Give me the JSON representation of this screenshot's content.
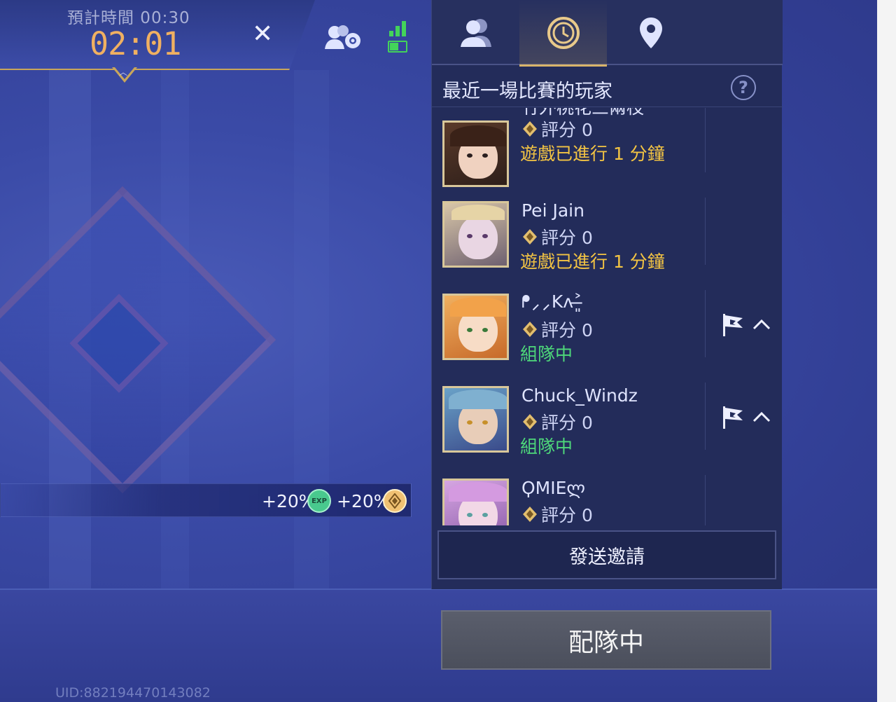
{
  "timer": {
    "estimated_label": "預計時間 00:30",
    "elapsed": "02:01"
  },
  "icons": {
    "close": "close-icon",
    "friends_settings": "friends-settings-icon",
    "signal": "signal-icon",
    "battery": "battery-icon"
  },
  "colors": {
    "accent_gold": "#d9b56a",
    "timer_orange": "#f0b061",
    "status_ingame": "#f3c443",
    "status_team": "#4ed87a",
    "signal_green": "#43d35a"
  },
  "tabs": [
    {
      "icon": "friends-icon"
    },
    {
      "icon": "recent-history-icon",
      "active": true
    },
    {
      "icon": "location-icon"
    }
  ],
  "panel": {
    "title": "最近一場比賽的玩家",
    "help": "?"
  },
  "players": [
    {
      "name": "竹外桃花三兩枝",
      "score": "評分 0",
      "status": "遊戲已進行 1 分鐘",
      "status_type": "ingame",
      "flag": false
    },
    {
      "name": "Pei Jain",
      "score": "評分 0",
      "status": "遊戲已進行 1 分鐘",
      "status_type": "ingame",
      "flag": false
    },
    {
      "name": "ᖰ⸝⸝Kʌ˃̶͈",
      "score": "評分 0",
      "status": "組隊中",
      "status_type": "team",
      "flag": true
    },
    {
      "name": "Chuck_Windz",
      "score": "評分 0",
      "status": "組隊中",
      "status_type": "team",
      "flag": true
    },
    {
      "name": "ϘMIEლ",
      "score": "評分 0",
      "status": "",
      "status_type": "none",
      "flag": false
    }
  ],
  "invite_label": "發送邀請",
  "matching_label": "配隊中",
  "bonus": {
    "exp_bonus": "+20%",
    "exp_badge": "EXP",
    "coin_bonus": "+20%"
  },
  "uid": "UID:882194470143082"
}
